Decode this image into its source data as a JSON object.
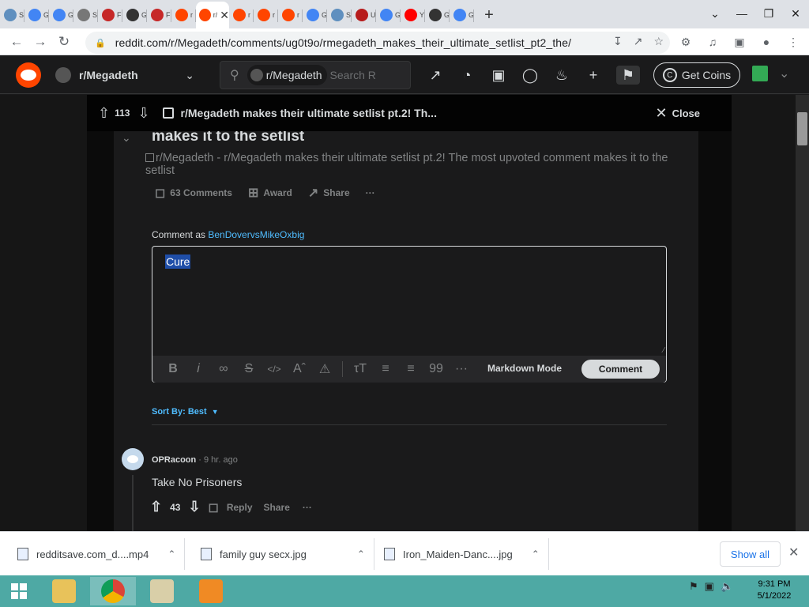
{
  "browser": {
    "tabs": [
      {
        "favicon": "globe-icon",
        "label": "S",
        "color": "#5f8fbf"
      },
      {
        "favicon": "google-icon",
        "label": "G",
        "color": "#4285f4"
      },
      {
        "favicon": "google-icon",
        "label": "G",
        "color": "#4285f4"
      },
      {
        "favicon": "s-icon",
        "label": "S",
        "color": "#777777"
      },
      {
        "favicon": "flag-icon",
        "label": "F",
        "color": "#c62828"
      },
      {
        "favicon": "github-icon",
        "label": "G",
        "color": "#333333"
      },
      {
        "favicon": "flag-icon",
        "label": "F",
        "color": "#c62828"
      },
      {
        "favicon": "reddit-icon",
        "label": "r",
        "color": "#ff4500"
      },
      {
        "favicon": "reddit-icon",
        "label": "r/",
        "color": "#ff4500",
        "active": true
      },
      {
        "favicon": "reddit-icon",
        "label": "r",
        "color": "#ff4500"
      },
      {
        "favicon": "reddit-icon",
        "label": "r",
        "color": "#ff4500"
      },
      {
        "favicon": "reddit-icon",
        "label": "r",
        "color": "#ff4500"
      },
      {
        "favicon": "google-icon",
        "label": "G",
        "color": "#4285f4"
      },
      {
        "favicon": "globe-icon",
        "label": "S",
        "color": "#5f8fbf"
      },
      {
        "favicon": "user-icon",
        "label": "U",
        "color": "#b71c1c"
      },
      {
        "favicon": "google-icon",
        "label": "G",
        "color": "#4285f4"
      },
      {
        "favicon": "youtube-icon",
        "label": "Y",
        "color": "#ff0000"
      },
      {
        "favicon": "github-icon",
        "label": "G",
        "color": "#333333"
      },
      {
        "favicon": "google-icon",
        "label": "G",
        "color": "#4285f4"
      }
    ],
    "url": "reddit.com/r/Megadeth/comments/ug0t9o/rmegadeth_makes_their_ultimate_setlist_pt2_the/"
  },
  "reddit": {
    "subreddit": "r/Megadeth",
    "search_chip": "r/Megadeth",
    "search_placeholder": "Search R",
    "get_coins": "Get Coins"
  },
  "overlay": {
    "vote_count": "113",
    "title": "r/Megadeth makes their ultimate setlist pt.2! Th...",
    "close_label": "Close"
  },
  "post": {
    "title_fragment": "makes it to the setlist",
    "image_alt": "r/Megadeth - r/Megadeth makes their ultimate setlist pt.2! The most upvoted comment makes it to the setlist",
    "comments_label": "63 Comments",
    "award_label": "Award",
    "share_label": "Share",
    "more_label": "···"
  },
  "composer": {
    "comment_as_prefix": "Comment as ",
    "username": "BenDovervsMikeOxbig",
    "text": "Cure",
    "markdown_mode": "Markdown Mode",
    "comment_button": "Comment"
  },
  "sort": {
    "label": "Sort By: Best"
  },
  "comments": [
    {
      "author": "OPRacoon",
      "time": " · 9 hr. ago",
      "text": "Take No Prisoners",
      "votes": "43",
      "reply": "Reply",
      "share": "Share",
      "more": "···"
    }
  ],
  "downloads": [
    {
      "name": "redditsave.com_d....mp4"
    },
    {
      "name": "family guy secx.jpg"
    },
    {
      "name": "Iron_Maiden-Danc....jpg"
    }
  ],
  "download_bar": {
    "show_all": "Show all"
  },
  "taskbar": {
    "time": "9:31 PM",
    "date": "5/1/2022"
  },
  "colors": {
    "reddit_orange": "#ff4500",
    "reddit_dark": "#1a1a1b",
    "link_blue": "#4fbcff",
    "taskbar": "#4ea9a4"
  }
}
